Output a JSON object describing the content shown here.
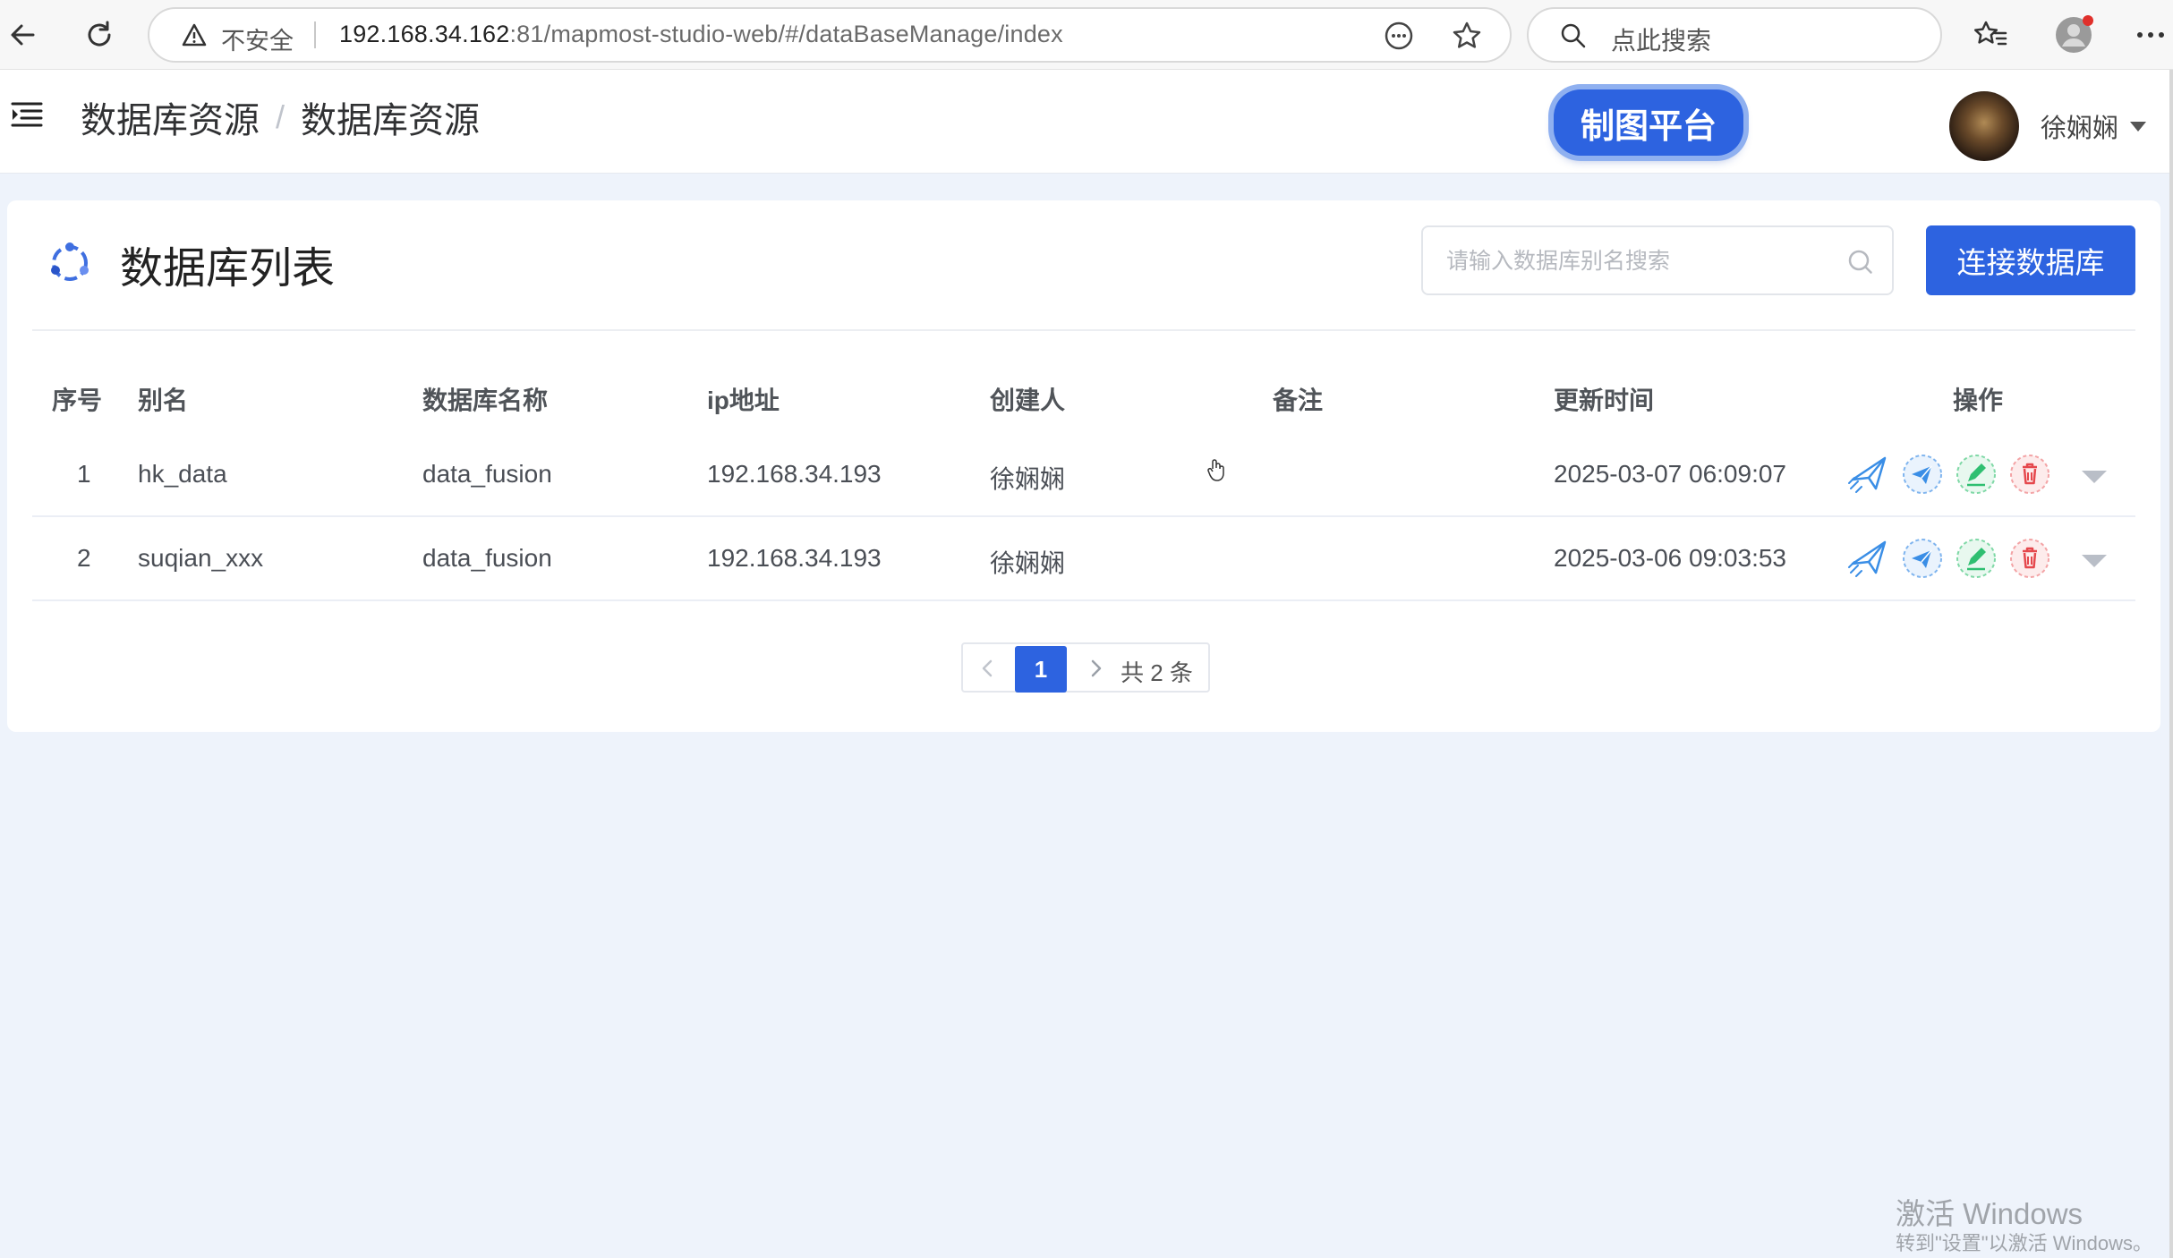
{
  "browser": {
    "insecure_label": "不安全",
    "url_host": "192.168.34.162",
    "url_rest": ":81/mapmost-studio-web/#/dataBaseManage/index",
    "search_placeholder": "点此搜索"
  },
  "header": {
    "breadcrumb": [
      "数据库资源",
      "数据库资源"
    ],
    "breadcrumb_separator": "/",
    "platform_button": "制图平台",
    "user_name": "徐娴娴"
  },
  "card": {
    "title": "数据库列表",
    "search_placeholder": "请输入数据库别名搜索",
    "connect_button": "连接数据库"
  },
  "table": {
    "columns": [
      "序号",
      "别名",
      "数据库名称",
      "ip地址",
      "创建人",
      "备注",
      "更新时间",
      "操作"
    ],
    "rows": [
      {
        "index": "1",
        "alias": "hk_data",
        "db_name": "data_fusion",
        "ip": "192.168.34.193",
        "creator": "徐娴娴",
        "remark": "",
        "updated": "2025-03-07 06:09:07"
      },
      {
        "index": "2",
        "alias": "suqian_xxx",
        "db_name": "data_fusion",
        "ip": "192.168.34.193",
        "creator": "徐娴娴",
        "remark": "",
        "updated": "2025-03-06 09:03:53"
      }
    ],
    "operations": [
      "publish-icon",
      "send-icon",
      "edit-icon",
      "delete-icon",
      "more-caret"
    ]
  },
  "pagination": {
    "current_page": "1",
    "total_text": "共 2 条"
  },
  "watermark": {
    "line1": "激活 Windows",
    "line2": "转到\"设置\"以激活 Windows。"
  },
  "colors": {
    "primary": "#2d63e0",
    "background": "#eef3fb",
    "delete": "#e5484d",
    "edit": "#2fbf71",
    "send": "#3a8ee6"
  }
}
